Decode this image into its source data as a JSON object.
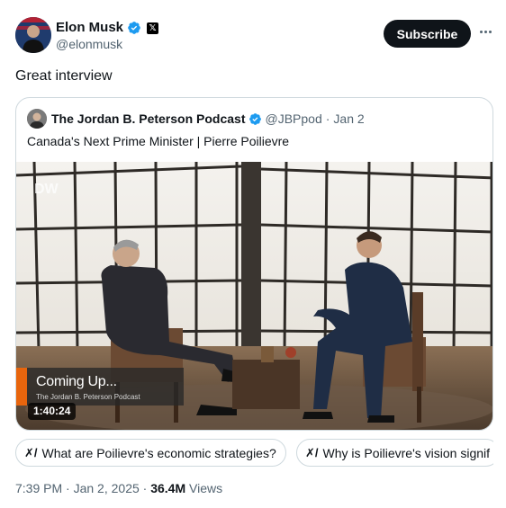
{
  "author": {
    "display_name": "Elon Musk",
    "handle": "@elonmusk",
    "affiliate_badge": "𝕏"
  },
  "subscribe_label": "Subscribe",
  "tweet_text": "Great interview",
  "quote": {
    "display_name": "The Jordan B. Peterson Podcast",
    "handle": "@JBPpod",
    "separator": "·",
    "date": "Jan 2",
    "text": "Canada's Next Prime Minister | Pierre Poilievre",
    "video": {
      "watermark": "DW",
      "overlay_title": "Coming Up...",
      "overlay_subtitle": "The Jordan B. Peterson Podcast",
      "duration": "1:40:24"
    }
  },
  "grok_chips": [
    {
      "icon": "grok-icon",
      "label": "What are Poilievre's economic strategies?"
    },
    {
      "icon": "grok-icon",
      "label": "Why is Poilievre's vision signif"
    }
  ],
  "meta": {
    "time": "7:39 PM",
    "separator": "·",
    "date": "Jan 2, 2025",
    "sep2": "·",
    "views_count": "36.4M",
    "views_label": "Views"
  },
  "colors": {
    "verified_blue": "#1d9bf0",
    "text_primary": "#0f1419",
    "text_secondary": "#536471",
    "border": "#cfd9de",
    "accent_orange": "#e8650d"
  }
}
